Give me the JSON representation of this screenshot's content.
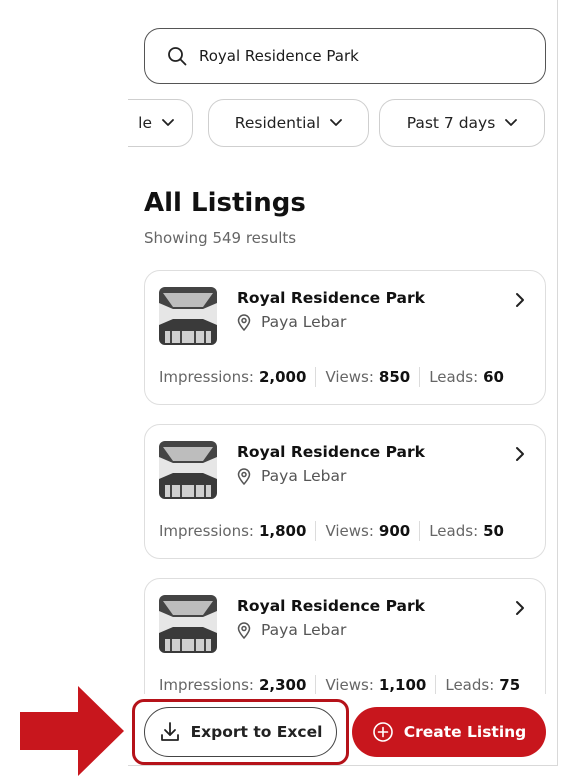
{
  "search": {
    "value": "Royal Residence Park",
    "icon": "search-icon"
  },
  "filters": [
    {
      "label": "le"
    },
    {
      "label": "Residential"
    },
    {
      "label": "Past 7 days"
    }
  ],
  "listings_header": {
    "title": "All Listings",
    "subtitle": "Showing 549 results"
  },
  "listings": [
    {
      "name": "Royal Residence Park",
      "location": "Paya Lebar",
      "impressions_label": "Impressions:",
      "impressions": "2,000",
      "views_label": "Views:",
      "views": "850",
      "leads_label": "Leads:",
      "leads": "60"
    },
    {
      "name": "Royal Residence Park",
      "location": "Paya Lebar",
      "impressions_label": "Impressions:",
      "impressions": "1,800",
      "views_label": "Views:",
      "views": "900",
      "leads_label": "Leads:",
      "leads": "50"
    },
    {
      "name": "Royal Residence Park",
      "location": "Paya Lebar",
      "impressions_label": "Impressions:",
      "impressions": "2,300",
      "views_label": "Views:",
      "views": "1,100",
      "leads_label": "Leads:",
      "leads": "75"
    }
  ],
  "actions": {
    "export_label": "Export to Excel",
    "create_label": "Create Listing"
  },
  "colors": {
    "brand_red": "#c8161d",
    "annotation_red": "#b51219"
  }
}
